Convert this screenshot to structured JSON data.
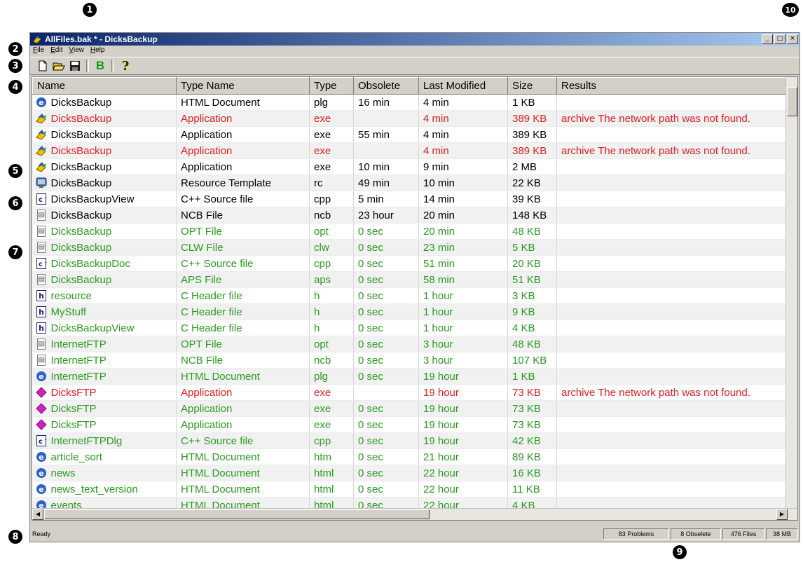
{
  "window": {
    "title": "AllFiles.bak * - DicksBackup",
    "min_glyph": "_",
    "max_glyph": "□",
    "close_glyph": "×"
  },
  "menu": [
    "File",
    "Edit",
    "View",
    "Help"
  ],
  "toolbar": {
    "bold_label": "B",
    "help_glyph": "?"
  },
  "callouts": [
    "1",
    "2",
    "3",
    "4",
    "5",
    "6",
    "7",
    "8",
    "9",
    "10"
  ],
  "table": {
    "columns": [
      "Name",
      "Type Name",
      "Type",
      "Obsolete",
      "Last Modified",
      "Size",
      "Results"
    ],
    "rows": [
      {
        "icon": "html",
        "status": "normal",
        "cells": [
          "DicksBackup",
          "HTML Document",
          "plg",
          "16 min",
          "4 min",
          "1 KB",
          ""
        ]
      },
      {
        "icon": "app",
        "status": "error",
        "cells": [
          "DicksBackup",
          "Application",
          "exe",
          "",
          "4 min",
          "389 KB",
          "archive  The network path was not found."
        ]
      },
      {
        "icon": "app",
        "status": "normal",
        "cells": [
          "DicksBackup",
          "Application",
          "exe",
          "55 min",
          "4 min",
          "389 KB",
          ""
        ]
      },
      {
        "icon": "app",
        "status": "error",
        "cells": [
          "DicksBackup",
          "Application",
          "exe",
          "",
          "4 min",
          "389 KB",
          "archive  The network path was not found."
        ]
      },
      {
        "icon": "app",
        "status": "normal",
        "cells": [
          "DicksBackup",
          "Application",
          "exe",
          "10 min",
          "9 min",
          "2 MB",
          ""
        ]
      },
      {
        "icon": "rc",
        "status": "normal",
        "cells": [
          "DicksBackup",
          "Resource Template",
          "rc",
          "49 min",
          "10 min",
          "22 KB",
          ""
        ]
      },
      {
        "icon": "cpp",
        "status": "normal",
        "cells": [
          "DicksBackupView",
          "C++ Source file",
          "cpp",
          "5 min",
          "14 min",
          "39 KB",
          ""
        ]
      },
      {
        "icon": "doc",
        "status": "normal",
        "cells": [
          "DicksBackup",
          "NCB File",
          "ncb",
          "23 hour",
          "20 min",
          "148 KB",
          ""
        ]
      },
      {
        "icon": "doc",
        "status": "ok",
        "cells": [
          "DicksBackup",
          "OPT File",
          "opt",
          "0 sec",
          "20 min",
          "48 KB",
          ""
        ]
      },
      {
        "icon": "doc",
        "status": "ok",
        "cells": [
          "DicksBackup",
          "CLW File",
          "clw",
          "0 sec",
          "23 min",
          "5 KB",
          ""
        ]
      },
      {
        "icon": "cpp",
        "status": "ok",
        "cells": [
          "DicksBackupDoc",
          "C++ Source file",
          "cpp",
          "0 sec",
          "51 min",
          "20 KB",
          ""
        ]
      },
      {
        "icon": "doc",
        "status": "ok",
        "cells": [
          "DicksBackup",
          "APS File",
          "aps",
          "0 sec",
          "58 min",
          "51 KB",
          ""
        ]
      },
      {
        "icon": "h",
        "status": "ok",
        "cells": [
          "resource",
          "C Header file",
          "h",
          "0 sec",
          "1 hour",
          "3 KB",
          ""
        ]
      },
      {
        "icon": "h",
        "status": "ok",
        "cells": [
          "MyStuff",
          "C Header file",
          "h",
          "0 sec",
          "1 hour",
          "9 KB",
          ""
        ]
      },
      {
        "icon": "h",
        "status": "ok",
        "cells": [
          "DicksBackupView",
          "C Header file",
          "h",
          "0 sec",
          "1 hour",
          "4 KB",
          ""
        ]
      },
      {
        "icon": "doc",
        "status": "ok",
        "cells": [
          "InternetFTP",
          "OPT File",
          "opt",
          "0 sec",
          "3 hour",
          "48 KB",
          ""
        ]
      },
      {
        "icon": "doc",
        "status": "ok",
        "cells": [
          "InternetFTP",
          "NCB File",
          "ncb",
          "0 sec",
          "3 hour",
          "107 KB",
          ""
        ]
      },
      {
        "icon": "html",
        "status": "ok",
        "cells": [
          "InternetFTP",
          "HTML Document",
          "plg",
          "0 sec",
          "19 hour",
          "1 KB",
          ""
        ]
      },
      {
        "icon": "diamond",
        "status": "error",
        "cells": [
          "DicksFTP",
          "Application",
          "exe",
          "",
          "19 hour",
          "73 KB",
          "archive  The network path was not found."
        ]
      },
      {
        "icon": "diamond",
        "status": "ok",
        "cells": [
          "DicksFTP",
          "Application",
          "exe",
          "0 sec",
          "19 hour",
          "73 KB",
          ""
        ]
      },
      {
        "icon": "diamond",
        "status": "ok",
        "cells": [
          "DicksFTP",
          "Application",
          "exe",
          "0 sec",
          "19 hour",
          "73 KB",
          ""
        ]
      },
      {
        "icon": "cpp",
        "status": "ok",
        "cells": [
          "InternetFTPDlg",
          "C++ Source file",
          "cpp",
          "0 sec",
          "19 hour",
          "42 KB",
          ""
        ]
      },
      {
        "icon": "html",
        "status": "ok",
        "cells": [
          "article_sort",
          "HTML Document",
          "htm",
          "0 sec",
          "21 hour",
          "89 KB",
          ""
        ]
      },
      {
        "icon": "html",
        "status": "ok",
        "cells": [
          "news",
          "HTML Document",
          "html",
          "0 sec",
          "22 hour",
          "16 KB",
          ""
        ]
      },
      {
        "icon": "html",
        "status": "ok",
        "cells": [
          "news_text_version",
          "HTML Document",
          "html",
          "0 sec",
          "22 hour",
          "11 KB",
          ""
        ]
      },
      {
        "icon": "html",
        "status": "ok",
        "cells": [
          "events",
          "HTML Document",
          "html",
          "0 sec",
          "22 hour",
          "4 KB",
          ""
        ]
      }
    ]
  },
  "statusbar": {
    "ready": "Ready",
    "problems": "83 Problems",
    "obsolete": "8 Obselete",
    "files": "476 Files",
    "size": "38 MB"
  },
  "colors": {
    "error": "#e02020",
    "ok": "#2a9a1e",
    "normal": "#000000",
    "titlebar_start": "#0a246a",
    "titlebar_end": "#a6caf0"
  }
}
